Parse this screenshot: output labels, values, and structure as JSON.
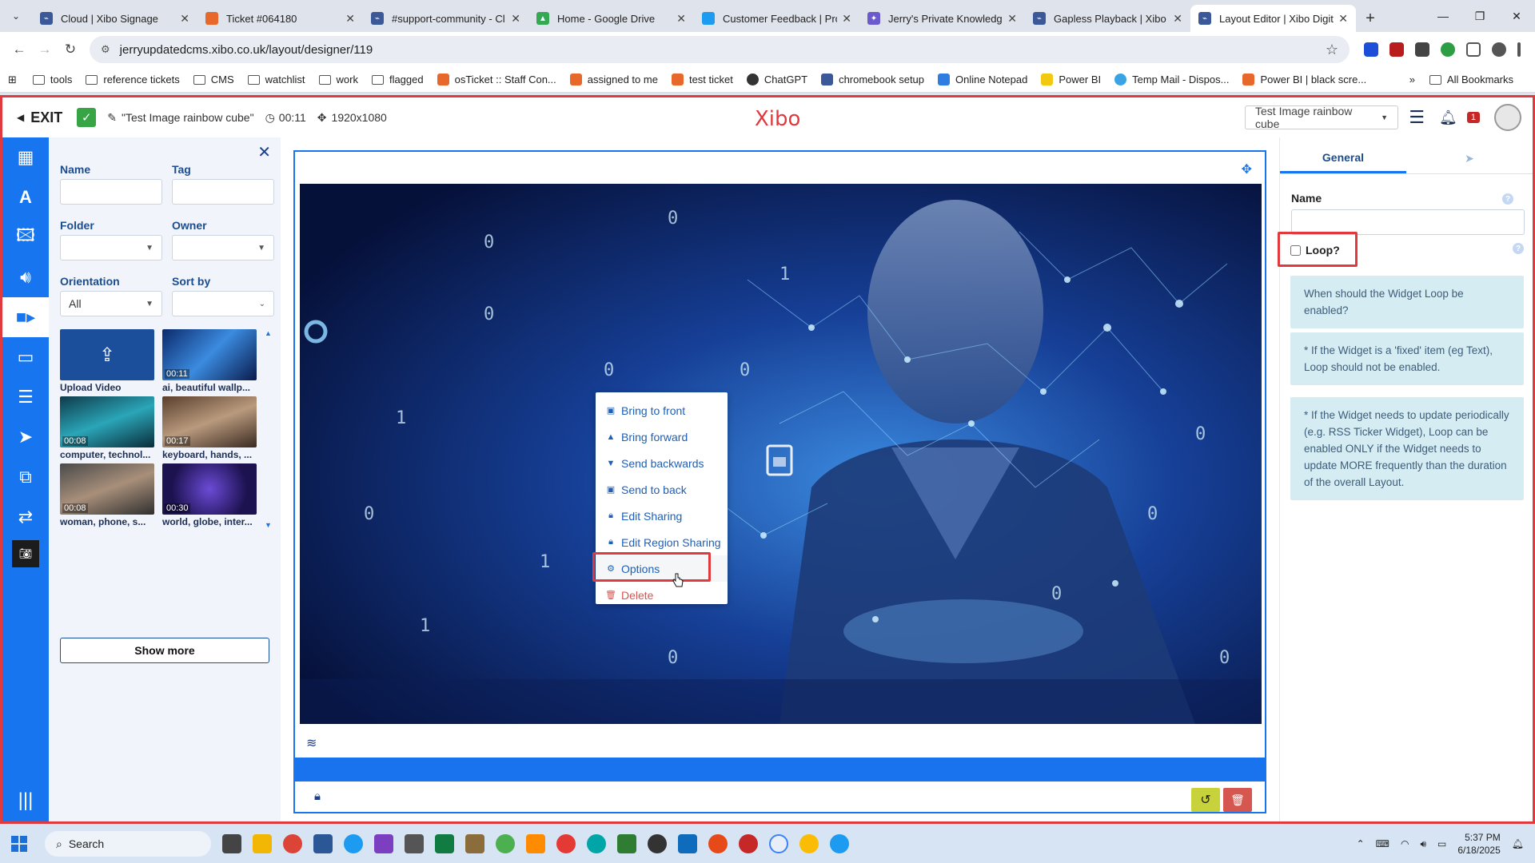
{
  "browser": {
    "tabs": [
      {
        "title": "Cloud | Xibo Signage",
        "color": "#3b5998"
      },
      {
        "title": "Ticket #064180",
        "color": "#e8672a"
      },
      {
        "title": "#support-community - Cl",
        "color": "#3b5998"
      },
      {
        "title": "Home - Google Drive",
        "color": "#34a853"
      },
      {
        "title": "Customer Feedback | Proc",
        "color": "#1d9bf0"
      },
      {
        "title": "Jerry's Private Knowledge",
        "color": "#6a5acd"
      },
      {
        "title": "Gapless Playback | Xibo D",
        "color": "#3b5998"
      },
      {
        "title": "Layout Editor | Xibo Digit",
        "color": "#3b5998"
      }
    ],
    "url": "jerryupdatedcms.xibo.co.uk/layout/designer/119",
    "bookmarks": [
      "tools",
      "reference tickets",
      "CMS",
      "watchlist",
      "work",
      "flagged",
      "osTicket :: Staff Con...",
      "assigned to me",
      "test ticket",
      "ChatGPT",
      "chromebook setup",
      "Online Notepad",
      "Power BI",
      "Temp Mail - Dispos...",
      "Power BI | black scre..."
    ],
    "all_bookmarks": "All Bookmarks"
  },
  "header": {
    "exit": "EXIT",
    "layout_name": "\"Test Image rainbow cube\"",
    "duration": "00:11",
    "resolution": "1920x1080",
    "logo": "Xibo",
    "layout_select": "Test Image rainbow cube",
    "notification_count": "1"
  },
  "toolbox": {
    "name_label": "Name",
    "tag_label": "Tag",
    "folder_label": "Folder",
    "owner_label": "Owner",
    "orientation_label": "Orientation",
    "orientation_value": "All",
    "sortby_label": "Sort by",
    "upload_label": "Upload Video",
    "items": [
      {
        "duration": "00:11",
        "caption": "ai, beautiful wallp..."
      },
      {
        "duration": "00:08",
        "caption": "computer, technol..."
      },
      {
        "duration": "00:17",
        "caption": "keyboard, hands, ..."
      },
      {
        "duration": "00:08",
        "caption": "woman, phone, s..."
      },
      {
        "duration": "00:30",
        "caption": "world, globe, inter..."
      }
    ],
    "show_more": "Show more"
  },
  "context_menu": {
    "items": [
      "Bring to front",
      "Bring forward",
      "Send backwards",
      "Send to back",
      "Edit Sharing",
      "Edit Region Sharing",
      "Options",
      "Delete"
    ]
  },
  "properties": {
    "tab_general": "General",
    "name_label": "Name",
    "loop_label": "Loop?",
    "help_1": "When should the Widget Loop be enabled?",
    "help_2": "* If the Widget is a 'fixed' item (eg Text), Loop should not be enabled.",
    "help_3": "* If the Widget needs to update periodically (e.g. RSS Ticker Widget), Loop can be enabled ONLY if the Widget needs to update MORE frequently than the duration of the overall Layout."
  },
  "taskbar": {
    "search": "Search",
    "time": "5:37 PM",
    "date": "6/18/2025"
  },
  "colors": {
    "accent": "#1875f0",
    "highlight": "#e0393e",
    "logo": "#e0393e"
  }
}
